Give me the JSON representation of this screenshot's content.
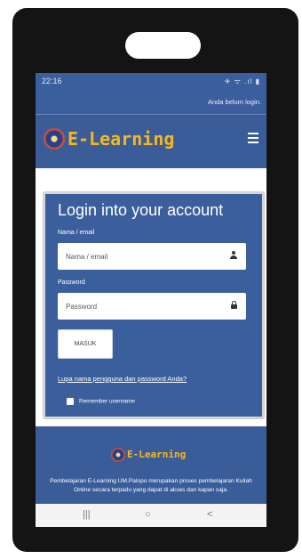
{
  "status_bar": {
    "time": "22:16",
    "icons": "✈ ᯤ .ıl ▮"
  },
  "header": {
    "notice": "Anda belum login.",
    "brand": "E-Learning"
  },
  "login": {
    "title": "Login into your account",
    "username_label": "Nama / email",
    "username_placeholder": "Nama / email",
    "password_label": "Password",
    "password_placeholder": "Password",
    "submit_label": "MASUK",
    "forgot_link": "Lupa nama pengguna dan password Anda?",
    "remember_label": "Remember username"
  },
  "footer": {
    "brand": "E-Learning",
    "description": "Pembelajaran E-Learning UM.Palopo merupakan proses pembelajaran Kuliah Online secara terpadu yang dapat di akses dan kapan saja."
  },
  "system_nav": {
    "recents": "|||",
    "home": "○",
    "back": "<"
  },
  "colors": {
    "primary": "#3b5f9c",
    "brand": "#f5b81f"
  },
  "icons": [
    "hamburger-menu-icon",
    "user-icon",
    "lock-icon",
    "logo-emblem"
  ]
}
